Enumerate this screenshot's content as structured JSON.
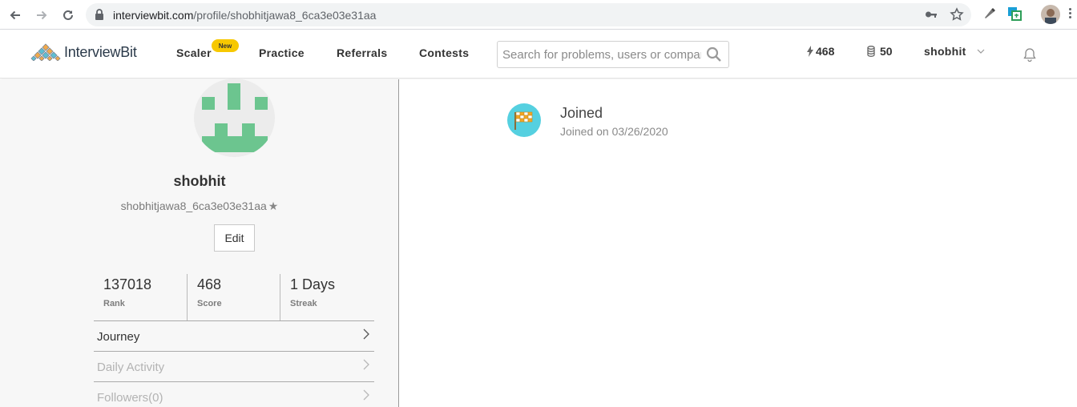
{
  "browser": {
    "url_host": "interviewbit.com",
    "url_path": "/profile/shobhitjawa8_6ca3e03e31aa"
  },
  "header": {
    "logo_text": "InterviewBit",
    "nav": [
      {
        "label": "Scaler",
        "badge": "New"
      },
      {
        "label": "Practice"
      },
      {
        "label": "Referrals"
      },
      {
        "label": "Contests"
      }
    ],
    "search_placeholder": "Search for problems, users or companies",
    "score": "468",
    "coins": "50",
    "username": "shobhit"
  },
  "profile": {
    "name": "shobhit",
    "handle": "shobhitjawa8_6ca3e03e31aa",
    "edit_label": "Edit",
    "stats": [
      {
        "value": "137018",
        "label": "Rank"
      },
      {
        "value": "468",
        "label": "Score"
      },
      {
        "value": "1 Days",
        "label": "Streak"
      }
    ],
    "menu": [
      {
        "label": "Journey",
        "enabled": true
      },
      {
        "label": "Daily Activity",
        "enabled": false
      },
      {
        "label": "Followers(0)",
        "enabled": false
      }
    ]
  },
  "timeline": {
    "event_title": "Joined",
    "event_date": "Joined on 03/26/2020"
  },
  "colors": {
    "avatar_green": "#6cc58f",
    "event_icon_bg": "#55d0e0",
    "badge_yellow": "#f7c800"
  }
}
